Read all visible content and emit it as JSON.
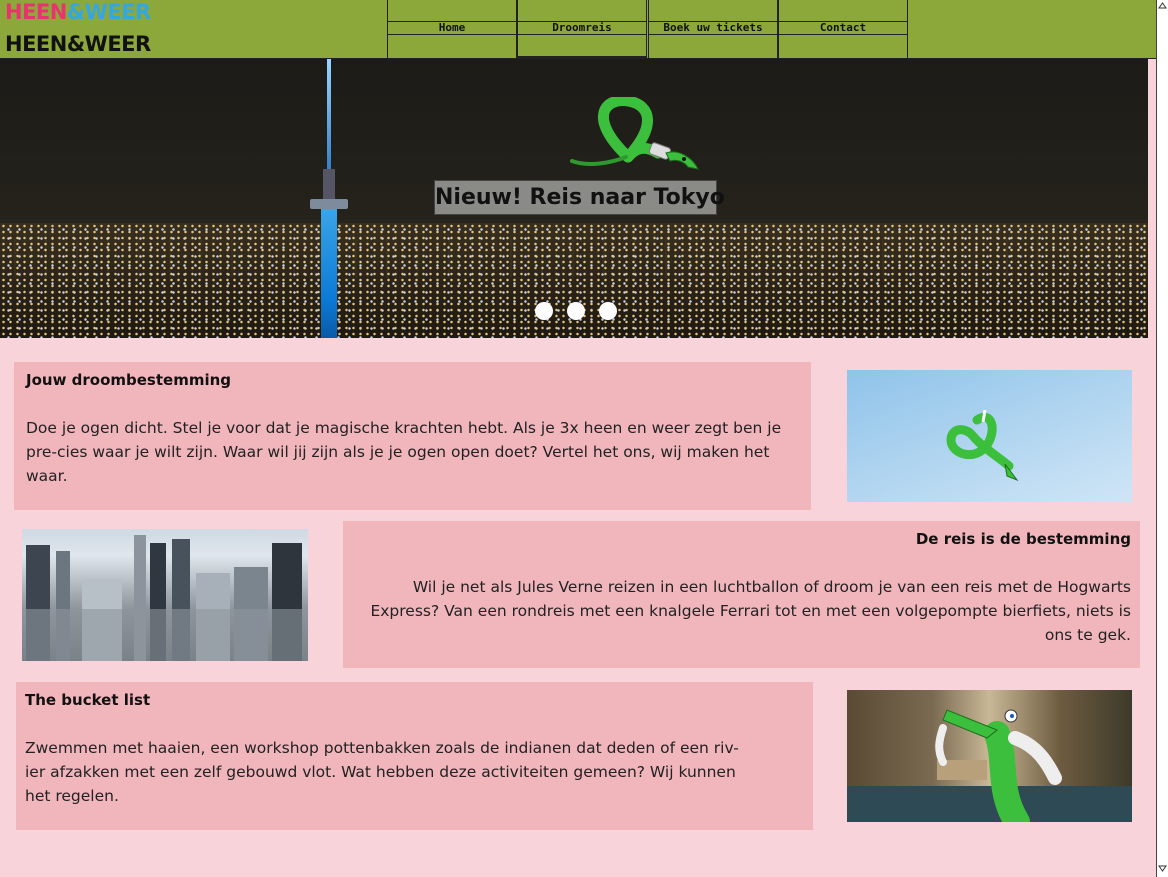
{
  "header": {
    "logo_top": {
      "part1": "HEEN",
      "amp": "&",
      "part2": "WEER"
    },
    "logo_bottom": {
      "part1": "HEEN",
      "amp": "&",
      "part2": "WEER"
    },
    "nav": [
      {
        "label": "Home"
      },
      {
        "label": "Droomreis"
      },
      {
        "label": "Boek uw tickets"
      },
      {
        "label": "Contact"
      }
    ],
    "active_nav": "Droomreis",
    "bg_color": "#8ca83a"
  },
  "hero": {
    "title": "Nieuw! Reis naar Tokyo",
    "slides": 3,
    "icon": "green-snake-ribbon-icon"
  },
  "sections": [
    {
      "title": "Jouw droombestemming",
      "text": "Doe je ogen dicht. Stel je voor dat je magische krachten hebt. Als je 3x heen en weer zegt ben je pre-cies waar je wilt zijn. Waar wil jij zijn als je je ogen open doet? Vertel het ons, wij maken het waar."
    },
    {
      "title": "De reis is de bestemming",
      "text": "Wil je net als Jules Verne reizen in een luchtballon of droom je van een reis met de Hogwarts Express? Van een rondreis met een knalgele Ferrari tot en met een volgepompte bierfiets, niets is ons te gek."
    },
    {
      "title": "The bucket list",
      "text": "Zwemmen met haaien, een workshop pottenbakken zoals de indianen dat deden of een riv-ier afzakken met een zelf gebouwd vlot. Wat hebben deze activiteiten gemeen? Wij kunnen het regelen."
    }
  ],
  "colors": {
    "page_bg": "#f9d3da",
    "block_bg": "#f0b6bc",
    "logo_pink": "#e8336f",
    "logo_blue": "#35a7e0"
  }
}
